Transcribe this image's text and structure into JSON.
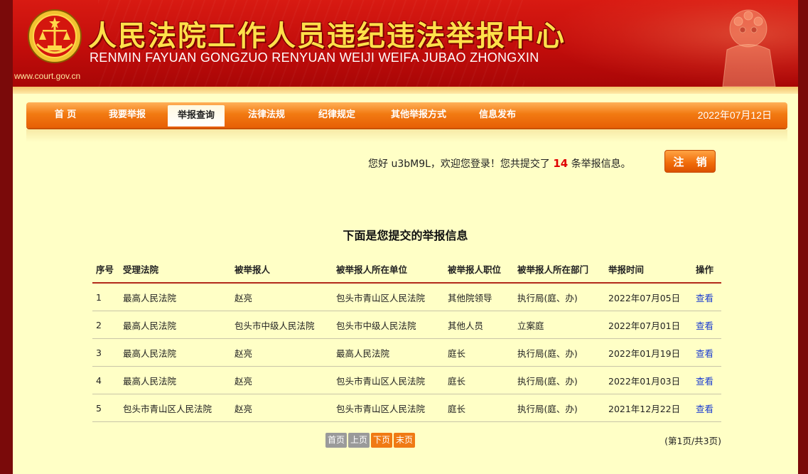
{
  "header": {
    "title_cn": "人民法院工作人员违纪违法举报中心",
    "title_en": "RENMIN FAYUAN GONGZUO RENYUAN WEIJI WEIFA JUBAO ZHONGXIN",
    "site_url": "www.court.gov.cn"
  },
  "nav": {
    "items": [
      {
        "label": "首 页",
        "active": false
      },
      {
        "label": "我要举报",
        "active": false
      },
      {
        "label": "举报查询",
        "active": true
      },
      {
        "label": "法律法规",
        "active": false
      },
      {
        "label": "纪律规定",
        "active": false
      },
      {
        "label": "其他举报方式",
        "active": false
      },
      {
        "label": "信息发布",
        "active": false
      }
    ],
    "date": "2022年07月12日"
  },
  "welcome": {
    "before": "您好 u3bM9L，欢迎您登录！您共提交了",
    "count": "14",
    "after": "条举报信息。",
    "logout_label": "注 销"
  },
  "section_title": "下面是您提交的举报信息",
  "table": {
    "headers": [
      "序号",
      "受理法院",
      "被举报人",
      "被举报人所在单位",
      "被举报人职位",
      "被举报人所在部门",
      "举报时间",
      "操作"
    ],
    "rows": [
      [
        "1",
        "最高人民法院",
        "赵亮",
        "包头市青山区人民法院",
        "其他院领导",
        "执行局(庭、办)",
        "2022年07月05日",
        "查看"
      ],
      [
        "2",
        "最高人民法院",
        "包头市中级人民法院",
        "包头市中级人民法院",
        "其他人员",
        "立案庭",
        "2022年07月01日",
        "查看"
      ],
      [
        "3",
        "最高人民法院",
        "赵亮",
        "最高人民法院",
        "庭长",
        "执行局(庭、办)",
        "2022年01月19日",
        "查看"
      ],
      [
        "4",
        "最高人民法院",
        "赵亮",
        "包头市青山区人民法院",
        "庭长",
        "执行局(庭、办)",
        "2022年01月03日",
        "查看"
      ],
      [
        "5",
        "包头市青山区人民法院",
        "赵亮",
        "包头市青山区人民法院",
        "庭长",
        "执行局(庭、办)",
        "2021年12月22日",
        "查看"
      ]
    ]
  },
  "pagination": {
    "first": "首页",
    "prev": "上页",
    "next": "下页",
    "last": "末页",
    "info": "(第1页/共3页)"
  },
  "colors": {
    "banner_red": "#c20d0b",
    "nav_orange": "#f27a12",
    "page_bg": "#ffffc6",
    "link_blue": "#1b3cd0",
    "count_red": "#e00000"
  }
}
